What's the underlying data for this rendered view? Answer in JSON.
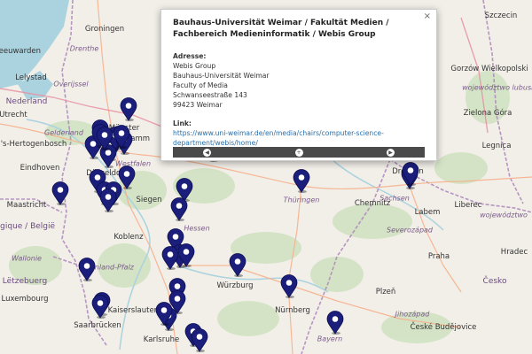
{
  "popup": {
    "title": "Bauhaus-Universität Weimar / Fakultät Medien / Fachbereich Medieninformatik / Webis Group",
    "address_heading": "Adresse:",
    "address_lines": [
      "Webis Group",
      "Bauhaus-Universität Weimar",
      "Faculty of Media",
      "Schwanseestraße 143",
      "99423 Weimar"
    ],
    "link_heading": "Link:",
    "link_text": "https://www.uni-weimar.de/en/media/chairs/computer-science-department/webis/home/",
    "close": "×",
    "nav": {
      "prev": "◀",
      "zoom": "+",
      "next": "▶"
    }
  },
  "map_labels": [
    {
      "text": "Groningen",
      "kind": "city"
    },
    {
      "text": "Drenthe",
      "kind": "region"
    },
    {
      "text": "Leeuwarden",
      "kind": "city"
    },
    {
      "text": "Lelystad",
      "kind": "city"
    },
    {
      "text": "Nederland",
      "kind": "country"
    },
    {
      "text": "Overijssel",
      "kind": "region"
    },
    {
      "text": "Utrecht",
      "kind": "city"
    },
    {
      "text": "Gelderland",
      "kind": "region"
    },
    {
      "text": "'s-Hertogenbosch",
      "kind": "city"
    },
    {
      "text": "Eindhoven",
      "kind": "city"
    },
    {
      "text": "Münster",
      "kind": "city"
    },
    {
      "text": "Hamm",
      "kind": "city"
    },
    {
      "text": "Düsseldorf",
      "kind": "city"
    },
    {
      "text": "Westfalen",
      "kind": "region"
    },
    {
      "text": "Siegen",
      "kind": "city"
    },
    {
      "text": "Maastricht",
      "kind": "city"
    },
    {
      "text": "Belgique / België",
      "kind": "country"
    },
    {
      "text": "Koblenz",
      "kind": "city"
    },
    {
      "text": "Hessen",
      "kind": "region"
    },
    {
      "text": "Wallonie",
      "kind": "region"
    },
    {
      "text": "Lëtzebuerg",
      "kind": "country"
    },
    {
      "text": "Rheinland-Pfalz",
      "kind": "region"
    },
    {
      "text": "Luxembourg",
      "kind": "city"
    },
    {
      "text": "Kaiserslautern",
      "kind": "city"
    },
    {
      "text": "Saarbrücken",
      "kind": "city"
    },
    {
      "text": "Karlsruhe",
      "kind": "city"
    },
    {
      "text": "Würzburg",
      "kind": "city"
    },
    {
      "text": "Nürnberg",
      "kind": "city"
    },
    {
      "text": "Bayern",
      "kind": "region"
    },
    {
      "text": "Thüringen",
      "kind": "region"
    },
    {
      "text": "Chemnitz",
      "kind": "city"
    },
    {
      "text": "Sachsen",
      "kind": "region"
    },
    {
      "text": "Dresden",
      "kind": "city"
    },
    {
      "text": "Liberec",
      "kind": "city"
    },
    {
      "text": "Labem",
      "kind": "city"
    },
    {
      "text": "Severozápad",
      "kind": "region"
    },
    {
      "text": "Praha",
      "kind": "city"
    },
    {
      "text": "Česko",
      "kind": "country"
    },
    {
      "text": "Jihozápad",
      "kind": "region"
    },
    {
      "text": "Plzeň",
      "kind": "city"
    },
    {
      "text": "České Budějovice",
      "kind": "city"
    },
    {
      "text": "Szczecin",
      "kind": "city"
    },
    {
      "text": "Gorzów Wielkopolski",
      "kind": "city"
    },
    {
      "text": "województwo lubuskie",
      "kind": "region"
    },
    {
      "text": "Zielona Góra",
      "kind": "city"
    },
    {
      "text": "Legnica",
      "kind": "city"
    },
    {
      "text": "województwo",
      "kind": "region"
    },
    {
      "text": "Hradec",
      "kind": "city"
    }
  ],
  "marker_count": 38,
  "colors": {
    "marker": "#1b1e7a",
    "land": "#f2efe9",
    "forest": "#add19e",
    "water": "#aad3df"
  }
}
